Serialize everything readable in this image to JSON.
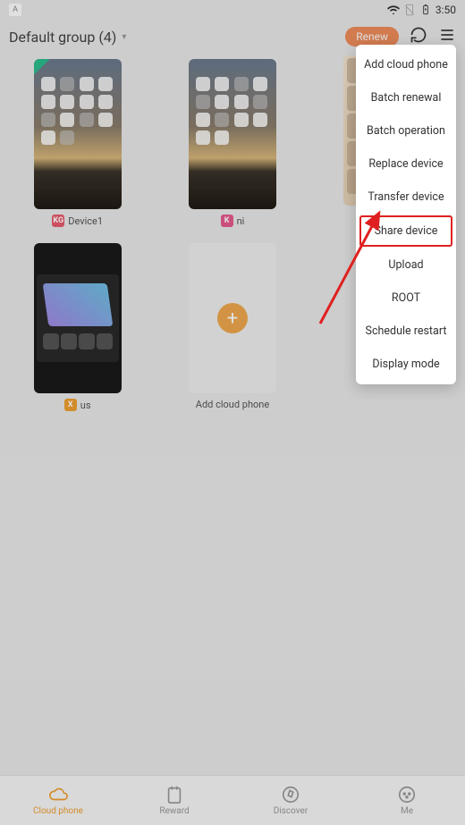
{
  "status_bar": {
    "time": "3:50"
  },
  "header": {
    "group_label": "Default group (4)",
    "renew_label": "Renew"
  },
  "devices": [
    {
      "name": "Device1",
      "badge": "KG",
      "badge_color": "red"
    },
    {
      "name": "ni",
      "badge": "K",
      "badge_color": "pink"
    },
    {
      "name": "us",
      "badge": "X",
      "badge_color": "orange"
    }
  ],
  "add_tile_label": "Add cloud phone",
  "dropdown": {
    "items": [
      "Add cloud phone",
      "Batch renewal",
      "Batch operation",
      "Replace device",
      "Transfer device",
      "Share device",
      "Upload",
      "ROOT",
      "Schedule restart",
      "Display mode"
    ],
    "highlighted_index": 5
  },
  "bottom_nav": {
    "items": [
      {
        "label": "Cloud phone",
        "active": true
      },
      {
        "label": "Reward",
        "active": false
      },
      {
        "label": "Discover",
        "active": false
      },
      {
        "label": "Me",
        "active": false
      }
    ]
  }
}
